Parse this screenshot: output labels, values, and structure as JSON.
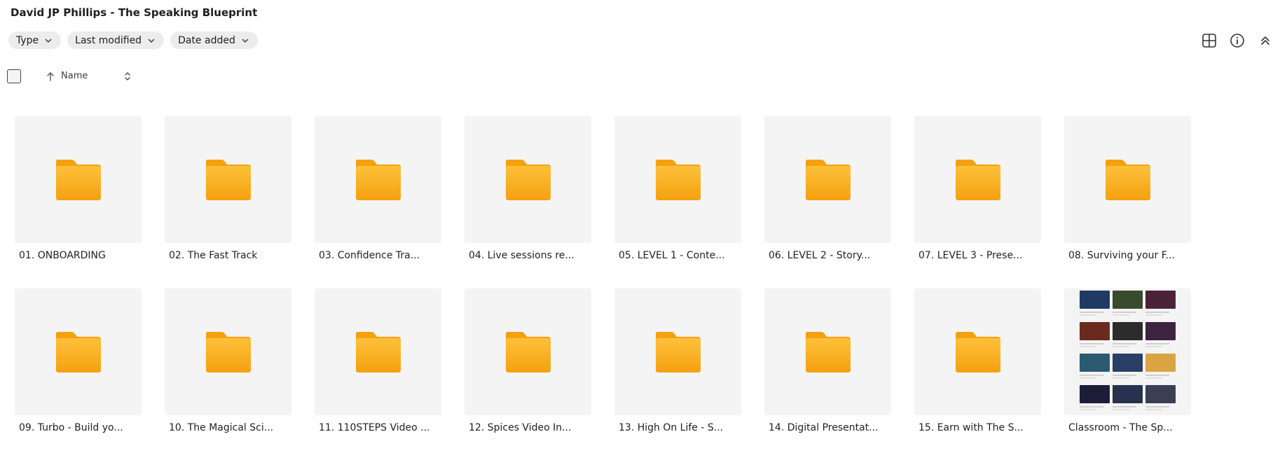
{
  "header": {
    "title": "David JP Phillips - The Speaking Blueprint"
  },
  "filters": [
    {
      "label": "Type"
    },
    {
      "label": "Last modified"
    },
    {
      "label": "Date added"
    }
  ],
  "top_icons": [
    "grid-view-icon",
    "info-icon",
    "collapse-up-icon"
  ],
  "sort": {
    "label": "Name",
    "direction": "ascending"
  },
  "colors": {
    "folder": "#fbb21e",
    "folder_dark": "#f5a00f",
    "thumb_bg": "#f4f4f4",
    "chip_bg": "#ececec"
  },
  "items": [
    {
      "name": "01. ONBOARDING",
      "type": "folder"
    },
    {
      "name": "02. The Fast Track",
      "type": "folder"
    },
    {
      "name": "03. Confidence Tra...",
      "type": "folder"
    },
    {
      "name": "04. Live sessions re...",
      "type": "folder"
    },
    {
      "name": "05. LEVEL 1 - Conte...",
      "type": "folder"
    },
    {
      "name": "06. LEVEL 2 - Story...",
      "type": "folder"
    },
    {
      "name": "07. LEVEL 3 - Prese...",
      "type": "folder"
    },
    {
      "name": "08. Surviving your F...",
      "type": "folder"
    },
    {
      "name": "09. Turbo - Build yo...",
      "type": "folder"
    },
    {
      "name": "10. The Magical Sci...",
      "type": "folder"
    },
    {
      "name": "11. 110STEPS Video ...",
      "type": "folder"
    },
    {
      "name": "12. Spices Video In...",
      "type": "folder"
    },
    {
      "name": "13. High On Life - S...",
      "type": "folder"
    },
    {
      "name": "14. Digital Presentat...",
      "type": "folder"
    },
    {
      "name": "15. Earn with The S...",
      "type": "folder"
    },
    {
      "name": "Classroom - The Sp...",
      "type": "document"
    }
  ],
  "classroom_preview_colors": [
    "#1f3b63",
    "#3a4a2c",
    "#4a2338",
    "#6b2a1e",
    "#2c2c2c",
    "#3c2440",
    "#2b5a73",
    "#2a3f66",
    "#d9a441",
    "#1d1d3a",
    "#27324f",
    "#3a3f52"
  ]
}
